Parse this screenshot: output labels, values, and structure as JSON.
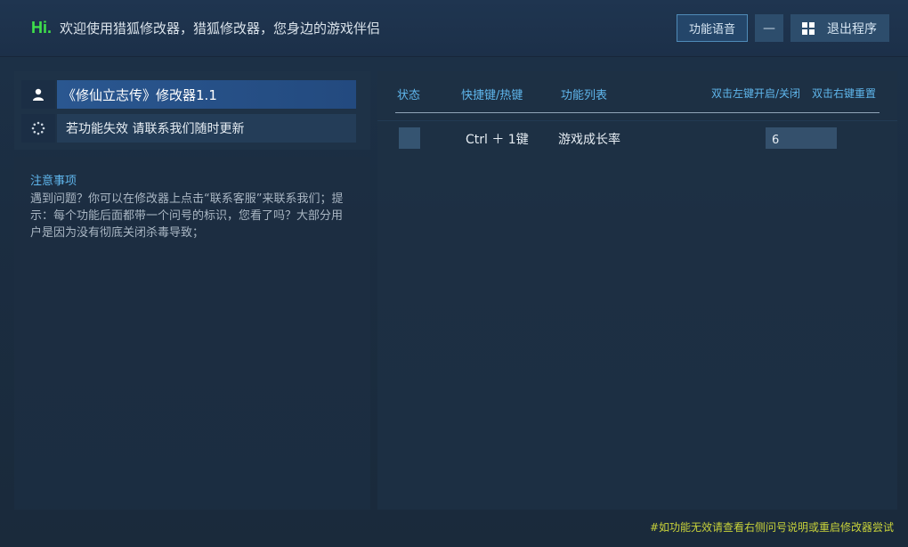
{
  "header": {
    "hi": "Hi.",
    "welcome": "欢迎使用猎狐修改器，猎狐修改器，您身边的游戏伴侣",
    "voice_button": "功能语音",
    "minimize_button": "—",
    "exit_button": "退出程序"
  },
  "left": {
    "game_title": "《修仙立志传》修改器1.1",
    "tip": "若功能失效  请联系我们随时更新",
    "notice_title": "注意事项",
    "notice_body": "遇到问题？你可以在修改器上点击“联系客服”来联系我们；提示：每个功能后面都带一个问号的标识，您看了吗？大部分用户是因为没有彻底关闭杀毒导致；"
  },
  "table": {
    "headers": {
      "status": "状态",
      "hotkey": "快捷键/热键",
      "feature_list": "功能列表",
      "left_click": "双击左键开启/关闭",
      "right_click": "双击右键重置"
    },
    "rows": [
      {
        "hotkey": "Ctrl ＋ 1键",
        "feature": "游戏成长率",
        "value": "6"
      }
    ]
  },
  "footer": "#如功能无效请查看右侧问号说明或重启修改器尝试",
  "icons": {
    "user": "user-icon",
    "loading": "loading-spinner-icon",
    "windows": "windows-icon"
  },
  "colors": {
    "hi_green": "#3fe04b",
    "accent_blue": "#5fb6ec",
    "footer_yellow": "#c8d23a"
  }
}
